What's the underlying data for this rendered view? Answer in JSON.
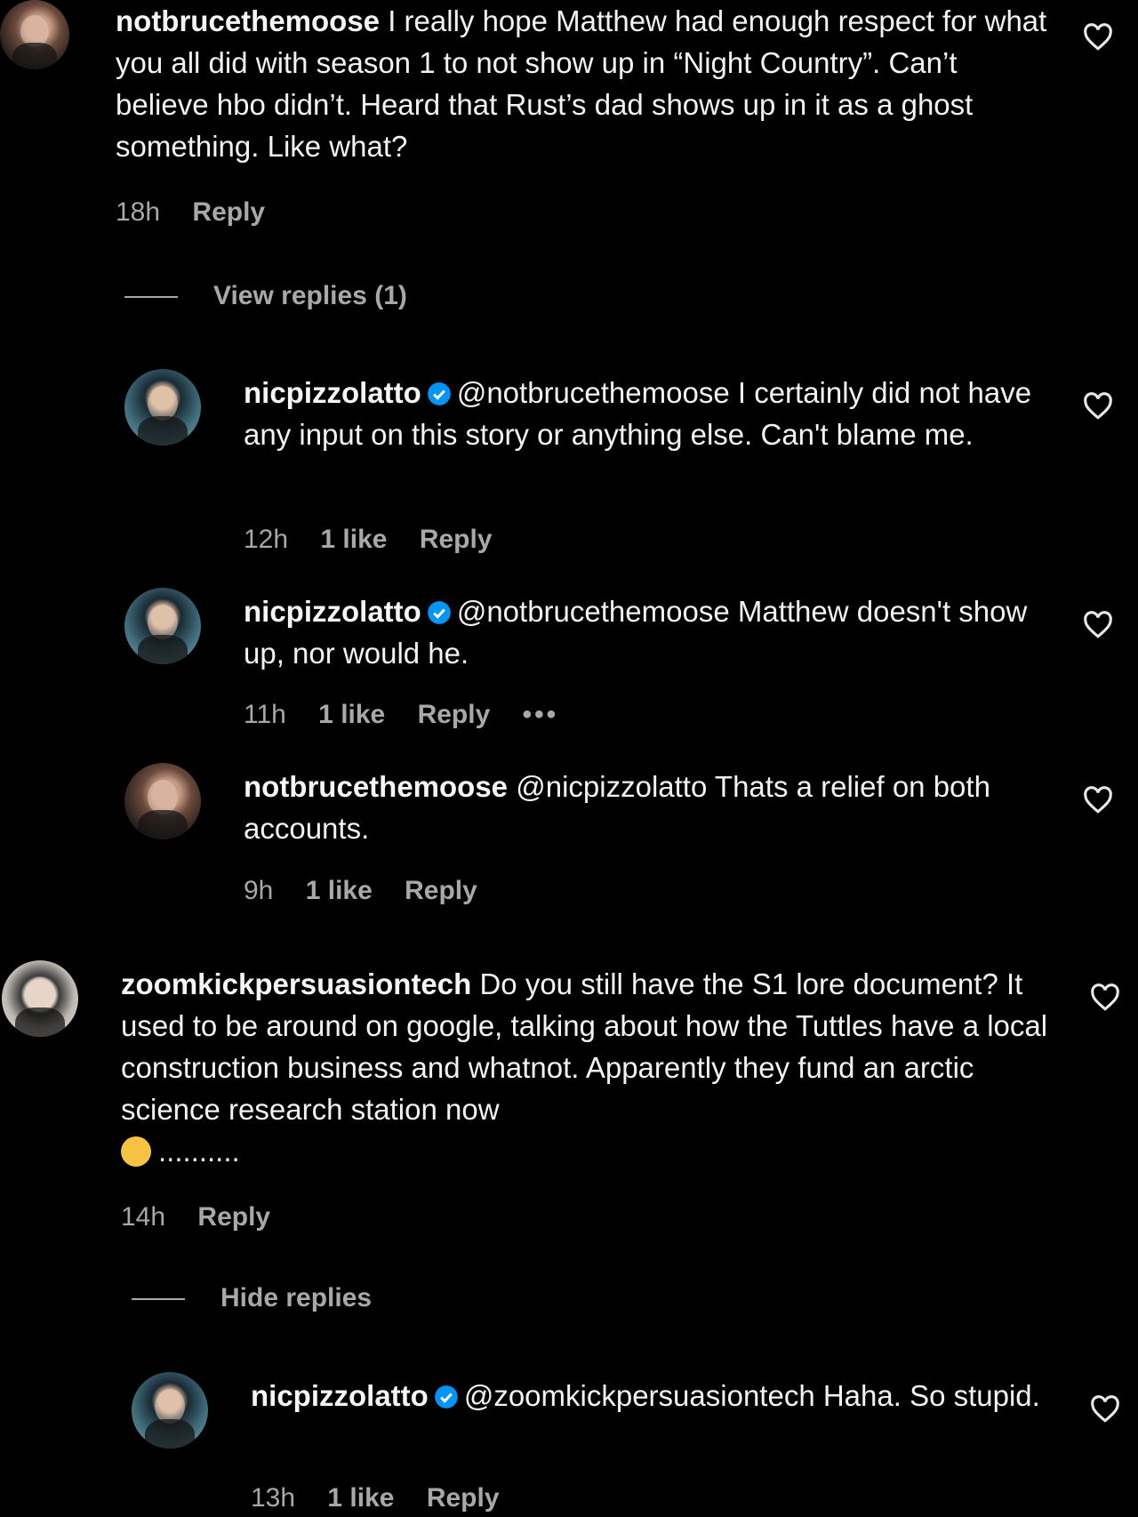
{
  "comments": [
    {
      "username": "notbrucethemoose",
      "text": "I really hope Matthew had enough respect for what you all did with season 1 to not show up in “Night Country”. Can’t believe hbo didn’t. Heard that Rust’s dad shows up in it as a ghost something. Like what?",
      "time": "18h",
      "reply_label": "Reply",
      "toggle": "View replies (1)",
      "replies": [
        {
          "username": "nicpizzolatto",
          "mention": "@notbrucethemoose",
          "text": "I certainly did not have any input on this story or anything else. Can't blame me.",
          "time": "12h",
          "likes": "1 like",
          "reply_label": "Reply"
        },
        {
          "username": "nicpizzolatto",
          "mention": "@notbrucethemoose",
          "text": "Matthew doesn't show up, nor would he.",
          "time": "11h",
          "likes": "1 like",
          "reply_label": "Reply",
          "more": "•••"
        },
        {
          "username": "notbrucethemoose",
          "mention": "@nicpizzolatto",
          "text": "Thats a relief on both accounts.",
          "time": "9h",
          "likes": "1 like",
          "reply_label": "Reply"
        }
      ]
    },
    {
      "username": "zoomkickpersuasiontech",
      "text": "Do you still have the S1 lore document? It used to be around on google, talking about how the Tuttles have a local construction business and whatnot. Apparently they fund an arctic science research station now",
      "trail": "..........",
      "time": "14h",
      "reply_label": "Reply",
      "toggle": "Hide replies",
      "replies": [
        {
          "username": "nicpizzolatto",
          "mention": "@zoomkickpersuasiontech",
          "text": "Haha. So stupid.",
          "time": "13h",
          "likes": "1 like",
          "reply_label": "Reply"
        }
      ]
    }
  ],
  "colors": {
    "background": "#000000",
    "text": "#f2f2f2",
    "muted": "#a8a8a8",
    "verified": "#0095f6"
  },
  "icons": [
    "heart-icon",
    "verified-badge-icon",
    "more-options-icon",
    "laughing-emoji-icon"
  ]
}
